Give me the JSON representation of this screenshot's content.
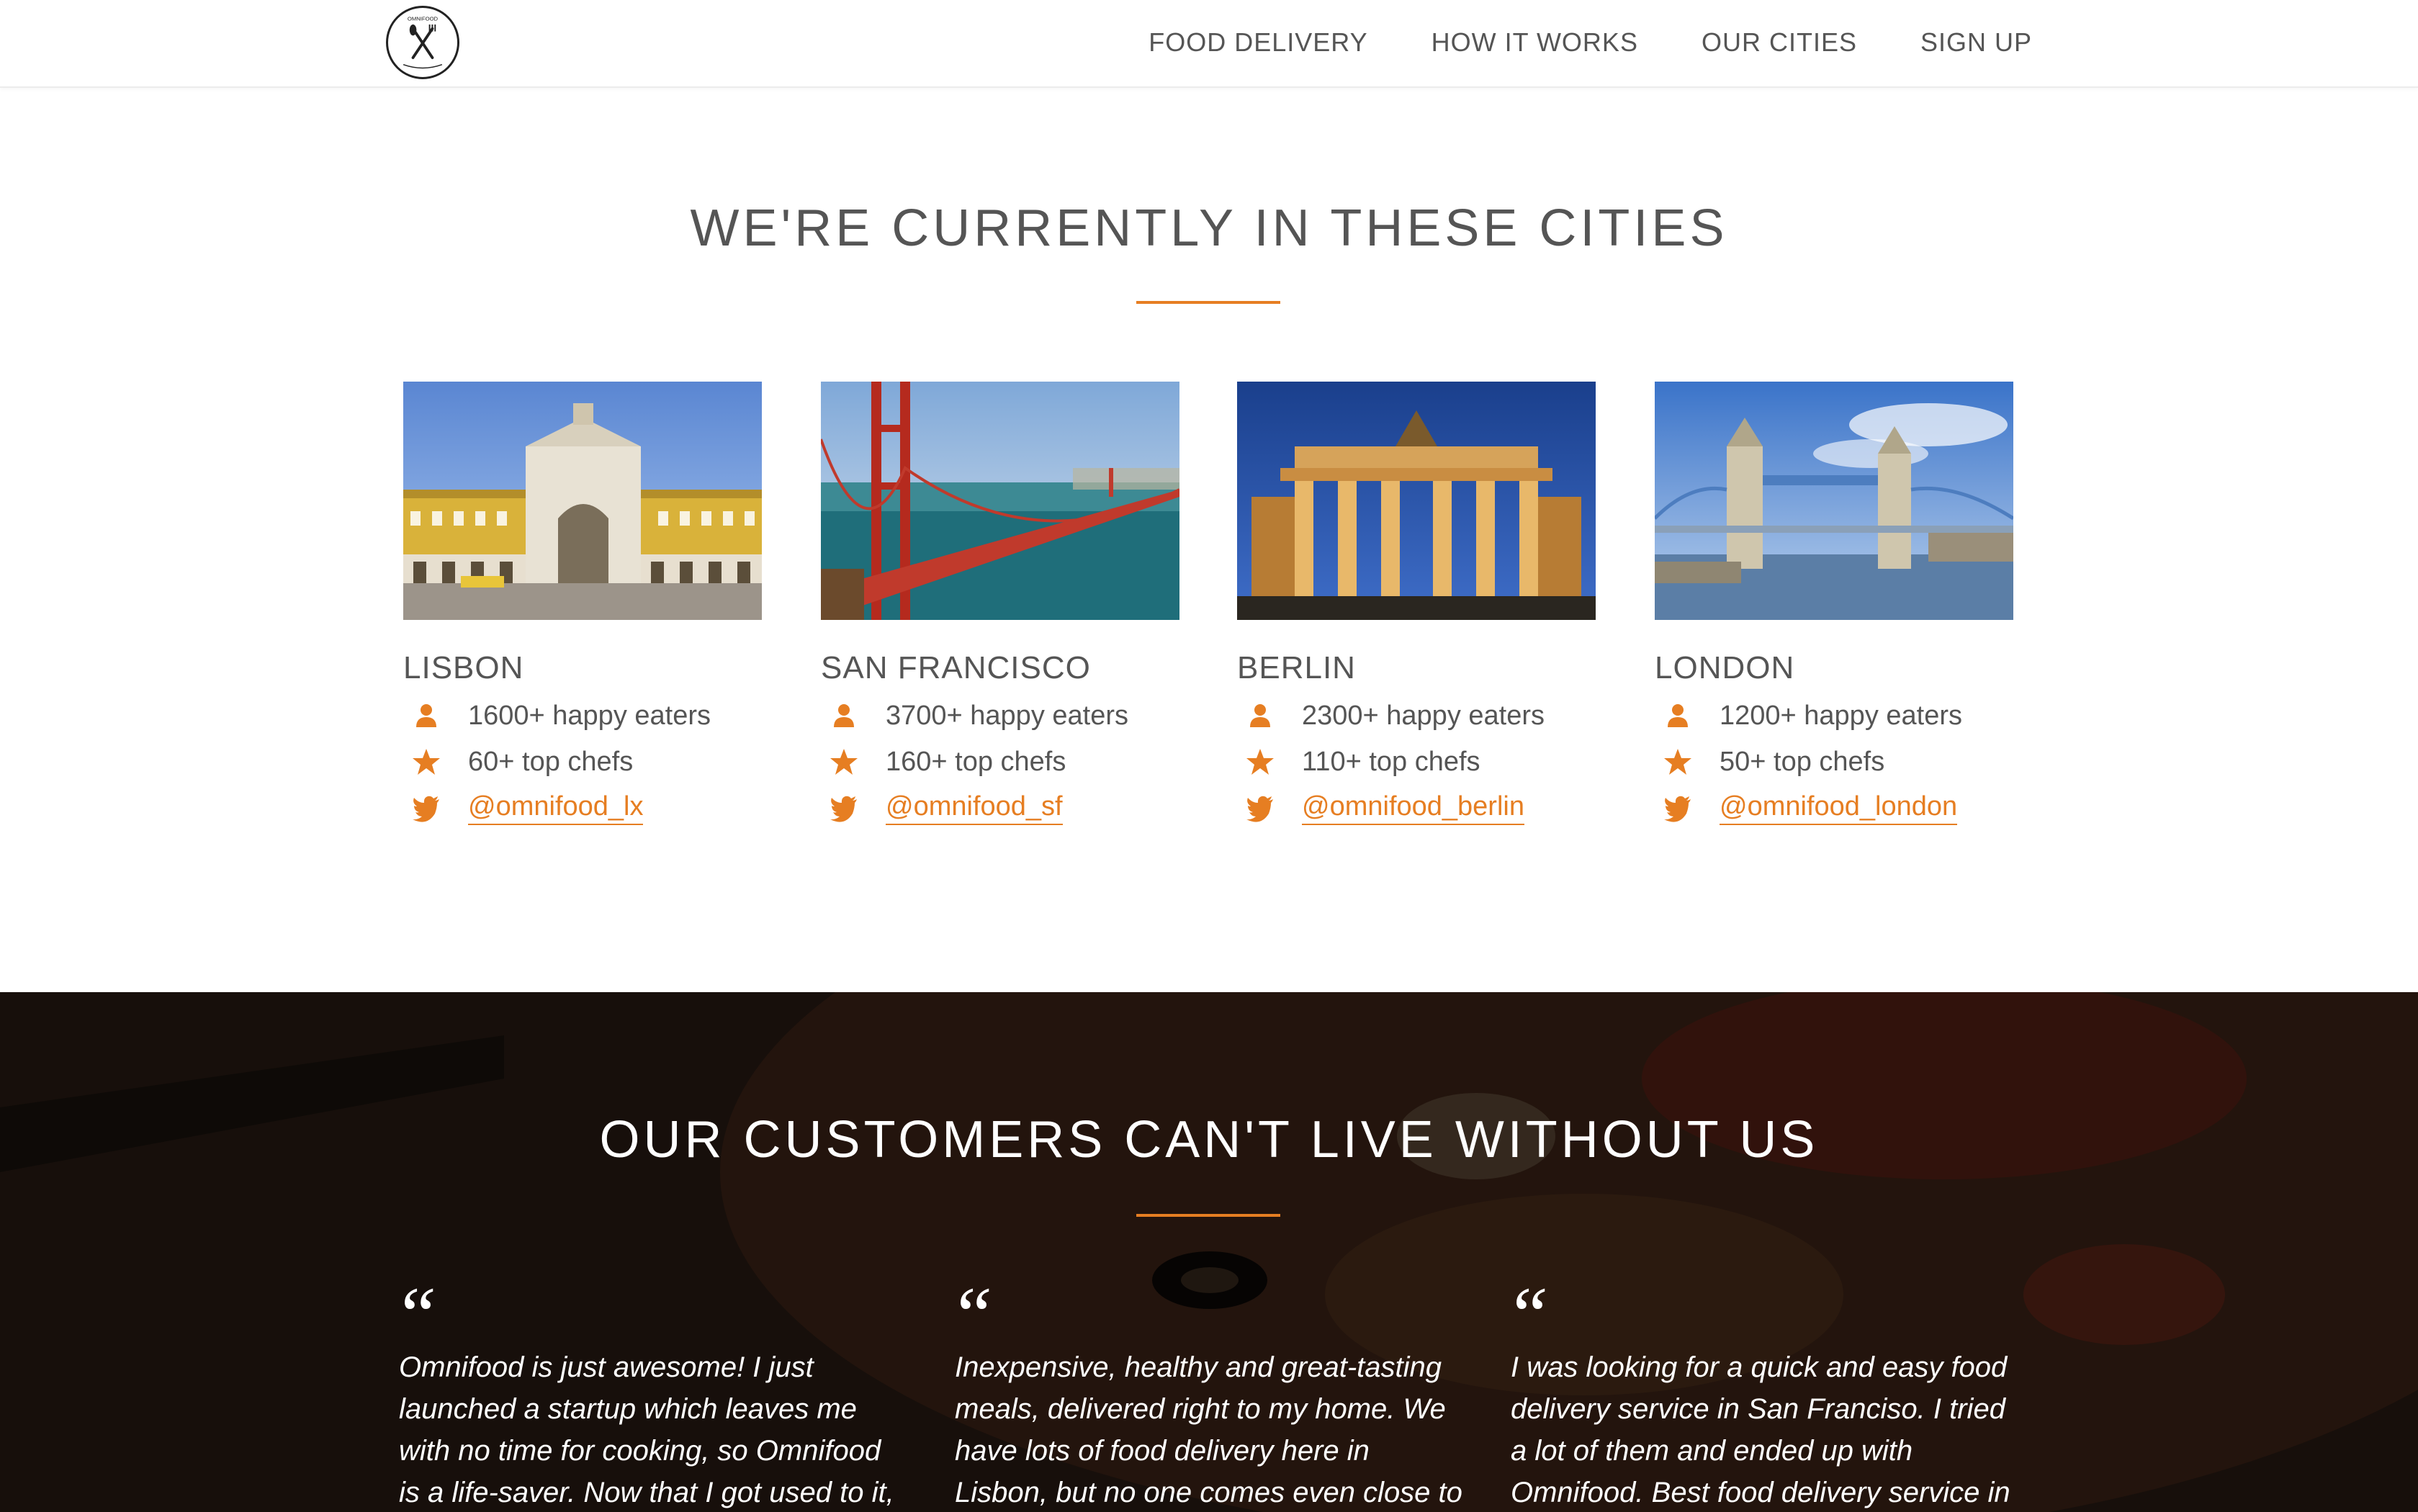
{
  "nav": {
    "links": [
      "FOOD DELIVERY",
      "HOW IT WORKS",
      "OUR CITIES",
      "SIGN UP"
    ],
    "logo_text": "OMNIFOOD"
  },
  "cities_section": {
    "title": "WE'RE CURRENTLY IN THESE CITIES",
    "cities": [
      {
        "name": "LISBON",
        "eaters": "1600+ happy eaters",
        "chefs": "60+ top chefs",
        "twitter": "@omnifood_lx"
      },
      {
        "name": "SAN FRANCISCO",
        "eaters": "3700+ happy eaters",
        "chefs": "160+ top chefs",
        "twitter": "@omnifood_sf"
      },
      {
        "name": "BERLIN",
        "eaters": "2300+ happy eaters",
        "chefs": "110+ top chefs",
        "twitter": "@omnifood_berlin"
      },
      {
        "name": "LONDON",
        "eaters": "1200+ happy eaters",
        "chefs": "50+ top chefs",
        "twitter": "@omnifood_london"
      }
    ]
  },
  "testimonials_section": {
    "title": "OUR CUSTOMERS CAN'T LIVE WITHOUT US",
    "quote_mark": "“",
    "quotes": [
      "Omnifood is just awesome! I just launched a startup which leaves me with no time for cooking, so Omnifood is a life-saver. Now that I got used to it, I couldn't live without",
      "Inexpensive, healthy and great-tasting meals, delivered right to my home. We have lots of food delivery here in Lisbon, but no one comes even close to Omifood. Me and my",
      "I was looking for a quick and easy food delivery service in San Franciso. I tried a lot of them and ended up with Omnifood. Best food delivery service in the Bay Area. Keep"
    ]
  },
  "colors": {
    "accent": "#e67e22",
    "text": "#555555",
    "dark_bg": "#2a1a12"
  },
  "icons": [
    "person-icon",
    "star-icon",
    "twitter-icon"
  ]
}
